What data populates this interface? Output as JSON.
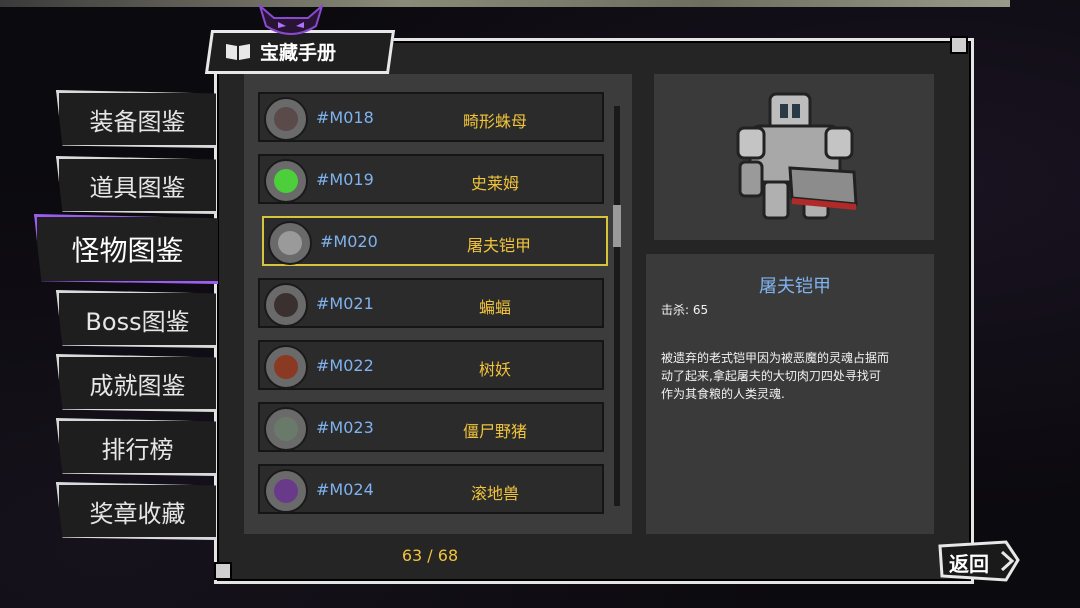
{
  "title": "宝藏手册",
  "sidebar": [
    {
      "label": "装备图鉴",
      "active": false
    },
    {
      "label": "道具图鉴",
      "active": false
    },
    {
      "label": "怪物图鉴",
      "active": true
    },
    {
      "label": "Boss图鉴",
      "active": false
    },
    {
      "label": "成就图鉴",
      "active": false
    },
    {
      "label": "排行榜",
      "active": false
    },
    {
      "label": "奖章收藏",
      "active": false
    }
  ],
  "monsters": [
    {
      "code": "#M018",
      "name": "畸形蛛母",
      "icon": "spider-icon",
      "color": "#5a4a4a",
      "selected": false
    },
    {
      "code": "#M019",
      "name": "史莱姆",
      "icon": "slime-icon",
      "color": "#4ccf3a",
      "selected": false
    },
    {
      "code": "#M020",
      "name": "屠夫铠甲",
      "icon": "armor-icon",
      "color": "#9a9a9a",
      "selected": true
    },
    {
      "code": "#M021",
      "name": "蝙蝠",
      "icon": "bat-icon",
      "color": "#3a3030",
      "selected": false
    },
    {
      "code": "#M022",
      "name": "树妖",
      "icon": "treant-icon",
      "color": "#8a3a22",
      "selected": false
    },
    {
      "code": "#M023",
      "name": "僵尸野猪",
      "icon": "boar-icon",
      "color": "#6a7a6a",
      "selected": false
    },
    {
      "code": "#M024",
      "name": "滚地兽",
      "icon": "beast-icon",
      "color": "#6a3a8a",
      "selected": false
    }
  ],
  "page_indicator": "63 / 68",
  "detail": {
    "name": "屠夫铠甲",
    "kills": "击杀: 65",
    "desc_lines": [
      "被遗弃的老式铠甲因为被恶魔的灵魂占据而",
      "动了起来,拿起屠夫的大切肉刀四处寻找可",
      "作为其食粮的人类灵魂."
    ]
  },
  "back_label": "返回",
  "colors": {
    "accent_purple": "#9b5cf0",
    "gold": "#f0c33a",
    "code_blue": "#7fb2ee",
    "select_yellow": "#d6c43a"
  }
}
